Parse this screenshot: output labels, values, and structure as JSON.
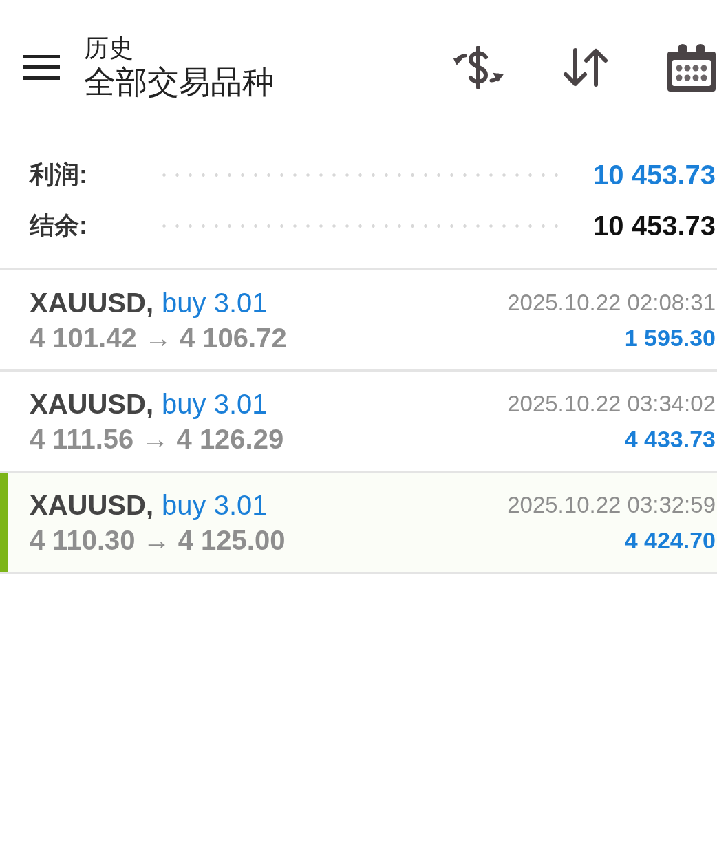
{
  "header": {
    "title": "历史",
    "subtitle": "全部交易品种"
  },
  "summary": [
    {
      "label": "利润:",
      "value": "10 453.73",
      "kind": "profit"
    },
    {
      "label": "结余:",
      "value": "10 453.73",
      "kind": "balance"
    }
  ],
  "deals": [
    {
      "symbol": "XAUUSD,",
      "order": "buy 3.01",
      "prices": "4 101.42 → 4 106.72",
      "time": "2025.10.22 02:08:31",
      "profit": "1 595.30",
      "selected": false
    },
    {
      "symbol": "XAUUSD,",
      "order": "buy 3.01",
      "prices": "4 111.56 → 4 126.29",
      "time": "2025.10.22 03:34:02",
      "profit": "4 433.73",
      "selected": false
    },
    {
      "symbol": "XAUUSD,",
      "order": "buy 3.01",
      "prices": "4 110.30 → 4 125.00",
      "time": "2025.10.22 03:32:59",
      "profit": "4 424.70",
      "selected": true
    }
  ]
}
